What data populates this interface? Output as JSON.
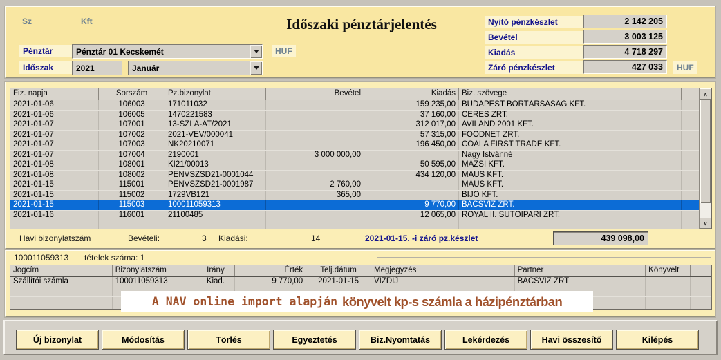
{
  "header": {
    "company_prefix": "Sz",
    "company_suffix": "Kft",
    "title": "Időszaki pénztárjelentés",
    "penztar_label": "Pénztár",
    "penztar_value": "Pénztár 01 Kecskemét",
    "currency": "HUF",
    "idoszak_label": "Időszak",
    "year": "2021",
    "month": "Január",
    "totals": [
      {
        "label": "Nyitó pénzkészlet",
        "value": "2 142 205"
      },
      {
        "label": "Bevétel",
        "value": "3 003 125"
      },
      {
        "label": "Kiadás",
        "value": "4 718 297"
      },
      {
        "label": "Záró pénzkészlet",
        "value": "427 033"
      }
    ],
    "totals_currency": "HUF"
  },
  "main_table": {
    "columns": [
      "Fiz. napja",
      "Sorszám",
      "Pz.bizonylat",
      "Bevétel",
      "Kiadás",
      "Biz. szövege"
    ],
    "selected_index": 10,
    "rows": [
      [
        "2021-01-06",
        "106003",
        "171011032",
        "",
        "159 235,00",
        "BUDAPEST BORTÁRSASÁG KFT."
      ],
      [
        "2021-01-06",
        "106005",
        "1470221583",
        "",
        "37 160,00",
        "CERES ZRT."
      ],
      [
        "2021-01-07",
        "107001",
        "13-SZLA-AT/2021",
        "",
        "312 017,00",
        "AVILAND 2001 KFT."
      ],
      [
        "2021-01-07",
        "107002",
        "2021-VEV/000041",
        "",
        "57 315,00",
        "FOODNET ZRT."
      ],
      [
        "2021-01-07",
        "107003",
        "NK20210071",
        "",
        "196 450,00",
        "COALA FIRST TRADE KFT."
      ],
      [
        "2021-01-07",
        "107004",
        "2190001",
        "3 000 000,00",
        "",
        "Nagy Istvánné"
      ],
      [
        "2021-01-08",
        "108001",
        "KI21/00013",
        "",
        "50 595,00",
        "MAZSI KFT."
      ],
      [
        "2021-01-08",
        "108002",
        "PENVSZSD21-0001044",
        "",
        "434 120,00",
        "MAUS KFT."
      ],
      [
        "2021-01-15",
        "115001",
        "PENVSZSD21-0001987",
        "2 760,00",
        "",
        "MAUS KFT."
      ],
      [
        "2021-01-15",
        "115002",
        "1729VB121",
        "365,00",
        "",
        "BIJÓ KFT."
      ],
      [
        "2021-01-15",
        "115003",
        "100011059313",
        "",
        "9 770,00",
        "BÁCSVÍZ ZRT."
      ],
      [
        "2021-01-16",
        "116001",
        "21100485",
        "",
        "12 065,00",
        "ROYAL II. SÜTŐIPARI ZRT."
      ],
      [
        "",
        "",
        "",
        "",
        "",
        ""
      ]
    ]
  },
  "summary": {
    "monthly_label": "Havi bizonylatszám",
    "bevetel_label": "Bevételi:",
    "bevetel_count": "3",
    "kiadas_label": "Kiadási:",
    "kiadas_count": "14",
    "closing_label": "2021-01-15. -i záró pz.készlet",
    "closing_value": "439 098,00"
  },
  "detail": {
    "doc_number": "100011059313",
    "items_label": "tételek száma: 1",
    "columns": [
      "Jogcím",
      "Bizonylatszám",
      "Irány",
      "Érték",
      "Telj.dátum",
      "Megjegyzés",
      "Partner",
      "Könyvelt"
    ],
    "rows": [
      [
        "Szállítói számla",
        "100011059313",
        "Kiad.",
        "9 770,00",
        "2021-01-15",
        "VÍZDIJ",
        "BÁCSVÍZ ZRT",
        ""
      ],
      [
        "",
        "",
        "",
        "",
        "",
        "",
        "",
        ""
      ],
      [
        "",
        "",
        "",
        "",
        "",
        "",
        "",
        ""
      ],
      [
        "",
        "",
        "",
        "",
        "",
        "",
        "",
        ""
      ]
    ],
    "note_mono": "A NAV online import alapján",
    "note_rest": "könyvelt kp-s számla a házipénztárban"
  },
  "buttons": [
    {
      "label": "Új bizonylat"
    },
    {
      "label": "Módosítás"
    },
    {
      "label": "Törlés"
    },
    {
      "label": "Egyeztetés"
    },
    {
      "label": "Biz.Nyomtatás"
    },
    {
      "label": "Lekérdezés"
    },
    {
      "label": "Havi összesítő"
    },
    {
      "label": "Kilépés"
    }
  ],
  "colors": {
    "accent_cream": "#f9e7a2",
    "selection_blue": "#0c6cd6",
    "label_navy": "#14148c",
    "note_brown": "#a0512b"
  }
}
